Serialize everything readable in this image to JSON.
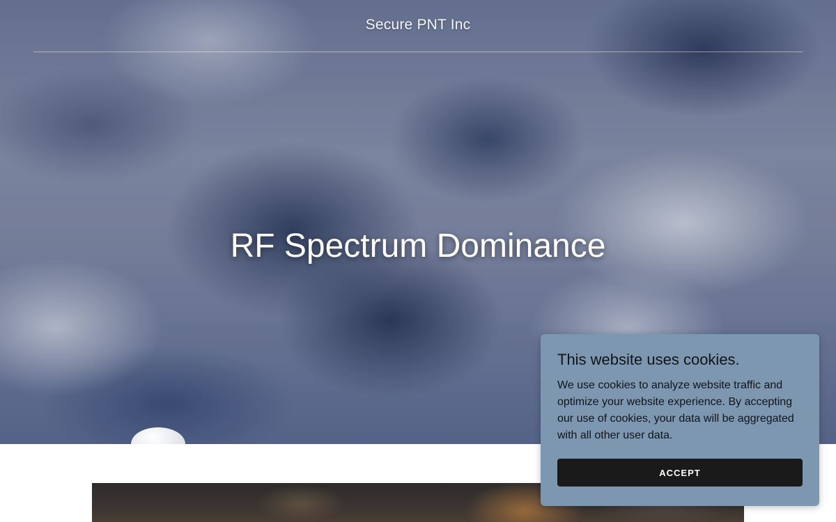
{
  "header": {
    "site_title": "Secure PNT Inc"
  },
  "hero": {
    "heading": "RF Spectrum Dominance"
  },
  "cookie_banner": {
    "title": "This website uses cookies.",
    "text": "We use cookies to analyze website traffic and optimize your website experience. By accepting our use of cookies, your data will be aggregated with all other user data.",
    "accept_label": "ACCEPT"
  }
}
